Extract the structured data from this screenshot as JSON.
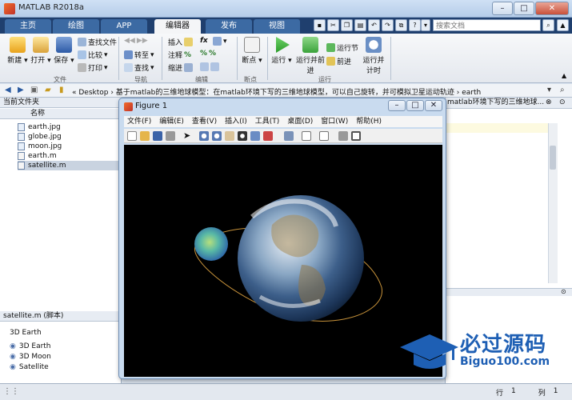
{
  "window": {
    "title": "MATLAB R2018a"
  },
  "tabs": [
    "主页",
    "绘图",
    "APP",
    "编辑器",
    "发布",
    "视图"
  ],
  "search": {
    "placeholder": "搜索文档"
  },
  "ribbon": {
    "file_group": {
      "label": "文件",
      "new": "新建",
      "open": "打开",
      "save": "保存",
      "find_files": "查找文件",
      "compare": "比较",
      "print": "打印"
    },
    "nav_group": {
      "label": "导航",
      "goto": "转至",
      "find": "查找"
    },
    "edit_group": {
      "label": "编辑",
      "insert": "插入",
      "comment": "注释",
      "indent": "缩进"
    },
    "breakpoint_group": {
      "label": "断点",
      "breakpoints": "断点"
    },
    "run_group": {
      "label": "运行",
      "run": "运行",
      "run_advance": "运行并前进",
      "run_section": "运行节",
      "advance": "前进",
      "run_time": "运行并计时"
    }
  },
  "address": {
    "path": "« Desktop › 基于matlab的三维地球模型：在matlab环境下写的三维地球模型，可以自己旋转，并可模拟卫星运动轨迹 › earth",
    "right_text": "matlab环境下写的三维地球..."
  },
  "current_folder": {
    "title": "当前文件夹",
    "column": "名称",
    "files": [
      "earth.jpg",
      "globe.jpg",
      "moon.jpg",
      "earth.m",
      "satellite.m"
    ],
    "selected": "satellite.m"
  },
  "details": {
    "header": "satellite.m (脚本)",
    "title": "3D Earth",
    "items": [
      "3D Earth",
      "3D Moon",
      "Satellite"
    ]
  },
  "figure": {
    "title": "Figure 1",
    "menu": [
      "文件(F)",
      "编辑(E)",
      "查看(V)",
      "插入(I)",
      "工具(T)",
      "桌面(D)",
      "窗口(W)",
      "帮助(H)"
    ]
  },
  "status": {
    "row_label": "行",
    "row": "1",
    "col_label": "列",
    "col": "1"
  },
  "watermark": {
    "title": "必过源码",
    "site": "Biguo100.com"
  },
  "colors": {
    "ribbon_tab_bg": "#1f3f6e",
    "active_tab": "#f4f5f7",
    "accent": "#2a5aa0",
    "watermark": "#1e5fb4"
  }
}
